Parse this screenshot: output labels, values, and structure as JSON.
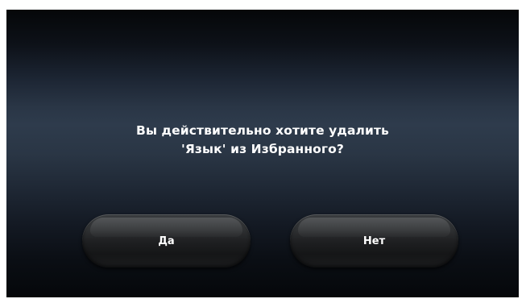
{
  "dialog": {
    "message_line1": "Вы действительно хотите удалить",
    "message_line2": "'Язык' из Избранного?"
  },
  "buttons": {
    "yes_label": "Да",
    "no_label": "Нет"
  }
}
